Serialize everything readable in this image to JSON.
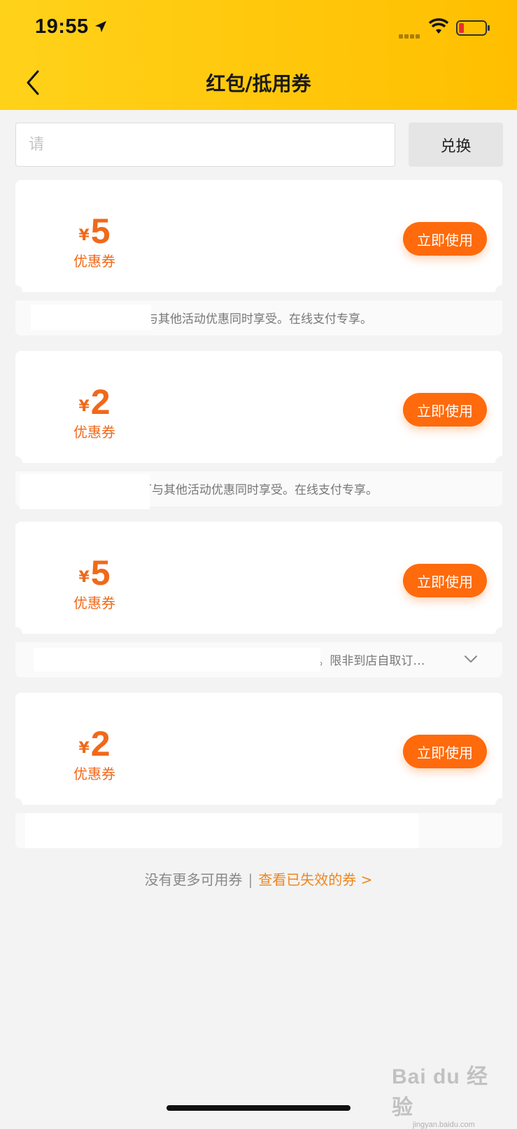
{
  "status_bar": {
    "time": "19:55"
  },
  "header": {
    "title": "红包/抵用券"
  },
  "redeem": {
    "placeholder": "请",
    "button_label": "兑换"
  },
  "coupons": [
    {
      "currency": "¥",
      "amount": "5",
      "label": "优惠券",
      "button": "立即使用",
      "terms": "可与其他活动优惠同时享受。在线支付专享。"
    },
    {
      "currency": "¥",
      "amount": "2",
      "label": "优惠券",
      "button": "立即使用",
      "terms": "可与其他活动优惠同时享受。在线支付专享。"
    },
    {
      "currency": "¥",
      "amount": "5",
      "label": "优惠券",
      "button": "立即使用",
      "terms": "用 。限非到店自取订…"
    },
    {
      "currency": "¥",
      "amount": "2",
      "label": "优惠券",
      "button": "立即使用",
      "terms": ""
    }
  ],
  "footer": {
    "no_more": "没有更多可用券",
    "separator": "|",
    "view_expired": "查看已失效的券 >"
  },
  "watermark": {
    "brand": "Bai du 经验",
    "url": "jingyan.baidu.com"
  },
  "colors": {
    "header": "#ffc80a",
    "accent": "#ff6a0c",
    "amount": "#f0691a",
    "link": "#f0861a",
    "background": "#f3f3f3"
  }
}
